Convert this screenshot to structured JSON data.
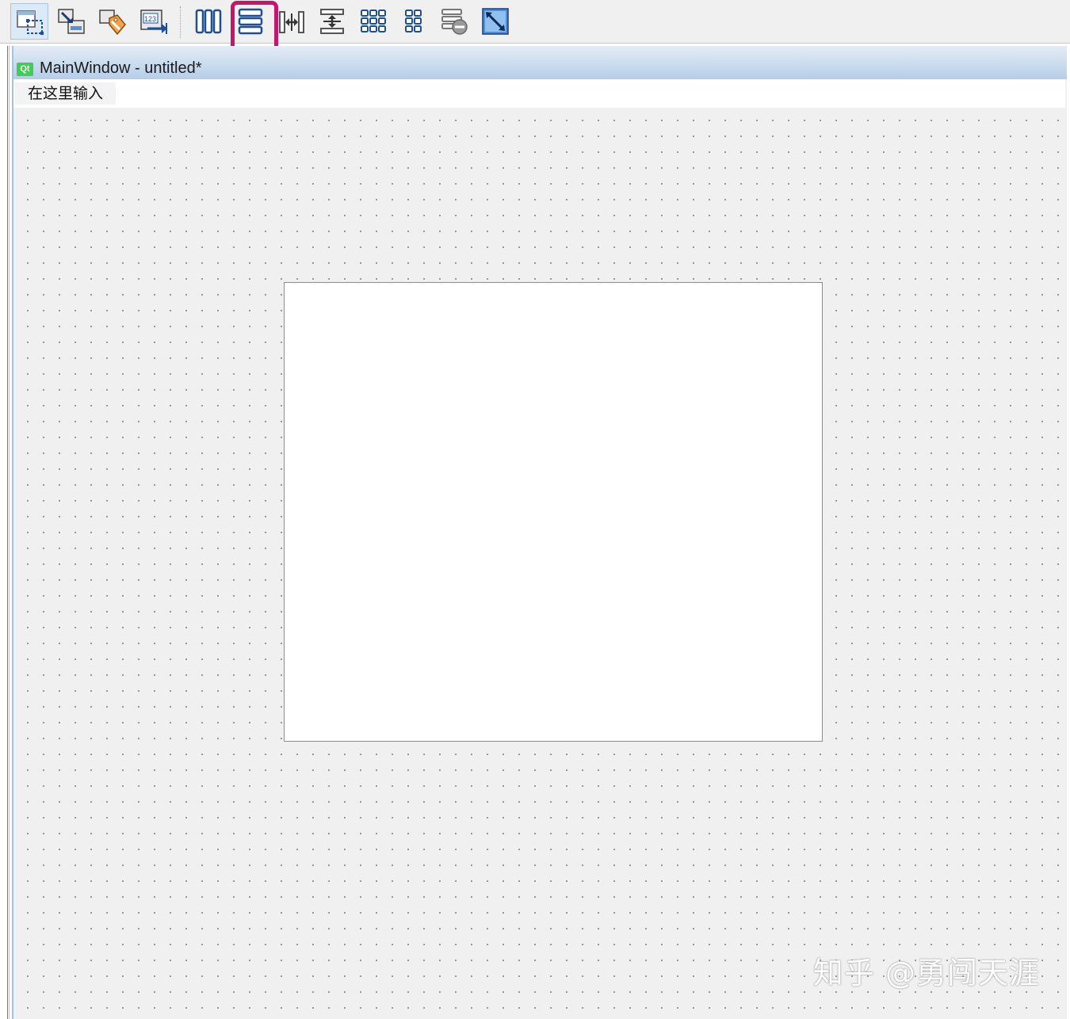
{
  "window": {
    "title": "MainWindow - untitled*",
    "icon_label": "Qt"
  },
  "menubar": {
    "placeholder_item": "在这里输入"
  },
  "toolbar": {
    "buttons": [
      {
        "name": "edit-widgets-icon",
        "active": true
      },
      {
        "name": "edit-signals-slots-icon"
      },
      {
        "name": "edit-buddies-icon"
      },
      {
        "name": "edit-tab-order-icon"
      },
      {
        "name": "layout-horizontal-icon"
      },
      {
        "name": "layout-vertical-icon",
        "highlighted": true
      },
      {
        "name": "layout-horizontal-splitter-icon"
      },
      {
        "name": "layout-vertical-splitter-icon"
      },
      {
        "name": "layout-grid-icon"
      },
      {
        "name": "layout-form-icon"
      },
      {
        "name": "break-layout-icon"
      },
      {
        "name": "adjust-size-icon"
      }
    ]
  },
  "colors": {
    "highlight": "#c4166a",
    "titlebar": "#c5d8ee",
    "canvas": "#f0f0f0"
  },
  "watermark": "知乎 @勇闯天涯"
}
